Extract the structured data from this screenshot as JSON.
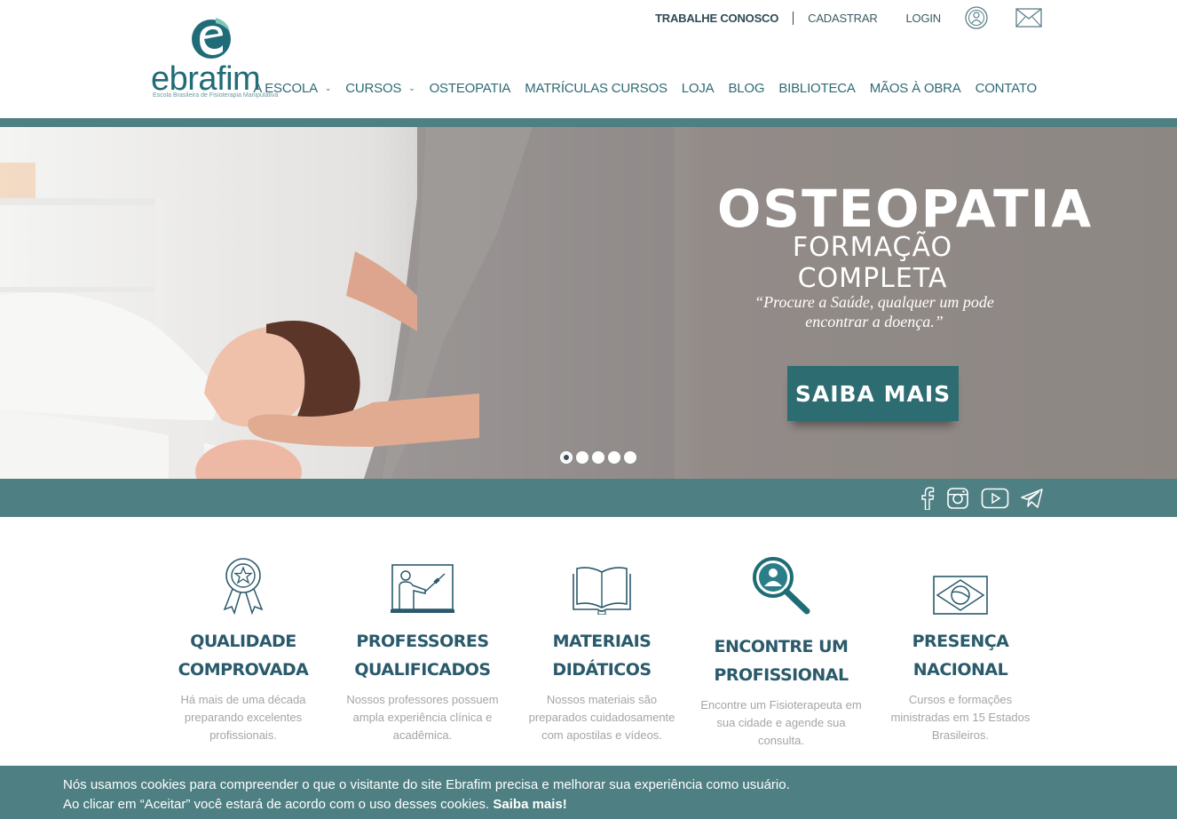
{
  "brand": {
    "name": "ebrafim",
    "tagline": "Escola Brasileira de Fisioterapia Manipulativa"
  },
  "topbar": {
    "work_with_us": "TRABALHE CONOSCO",
    "register": "CADASTRAR",
    "login": "LOGIN",
    "icons": [
      "profile-badge-icon",
      "mail-icon"
    ]
  },
  "nav": {
    "items": [
      {
        "label": "A ESCOLA",
        "has_dropdown": true
      },
      {
        "label": "CURSOS",
        "has_dropdown": true
      },
      {
        "label": "OSTEOPATIA",
        "has_dropdown": false
      },
      {
        "label": "MATRÍCULAS CURSOS",
        "has_dropdown": false
      },
      {
        "label": "LOJA",
        "has_dropdown": false
      },
      {
        "label": "BLOG",
        "has_dropdown": false
      },
      {
        "label": "BIBLIOTECA",
        "has_dropdown": false
      },
      {
        "label": "MÃOS À OBRA",
        "has_dropdown": false
      },
      {
        "label": "CONTATO",
        "has_dropdown": false
      }
    ]
  },
  "hero": {
    "title": "OSTEOPATIA",
    "subtitle": "FORMAÇÃO COMPLETA",
    "quote": "“Procure a Saúde, qualquer um pode encontrar a doença.”",
    "cta": "SAIBA MAIS",
    "slides": 5,
    "active_slide": 1
  },
  "social": [
    "facebook-icon",
    "instagram-icon",
    "youtube-icon",
    "telegram-icon"
  ],
  "features": [
    {
      "icon": "award-ribbon-icon",
      "title": "QUALIDADE COMPROVADA",
      "text": "Há mais de uma década preparando excelentes profissionais."
    },
    {
      "icon": "teacher-board-icon",
      "title": "PROFESSORES QUALIFICADOS",
      "text": "Nossos professores possuem ampla experiência clínica e acadêmica."
    },
    {
      "icon": "open-book-icon",
      "title": "MATERIAIS DIDÁTICOS",
      "text": "Nossos materiais são preparados cuidadosamente com apostilas e vídeos."
    },
    {
      "icon": "search-person-icon",
      "title": "ENCONTRE UM PROFISSIONAL",
      "text": "Encontre um Fisioterapeuta em sua cidade e agende sua consulta."
    },
    {
      "icon": "brazil-flag-icon",
      "title": "PRESENÇA NACIONAL",
      "text": "Cursos e formações ministradas em 15 Estados Brasileiros."
    }
  ],
  "cookie": {
    "text": "Nós usamos cookies para compreender o que o visitante do site Ebrafim precisa e melhorar sua experiência como usuário. Ao clicar em “Aceitar” você estará de acordo com o uso desses cookies.",
    "link": "Saiba mais!"
  },
  "colors": {
    "brand_teal": "#4e7f82",
    "heading": "#2a5a6b",
    "button": "#2d6c71"
  }
}
